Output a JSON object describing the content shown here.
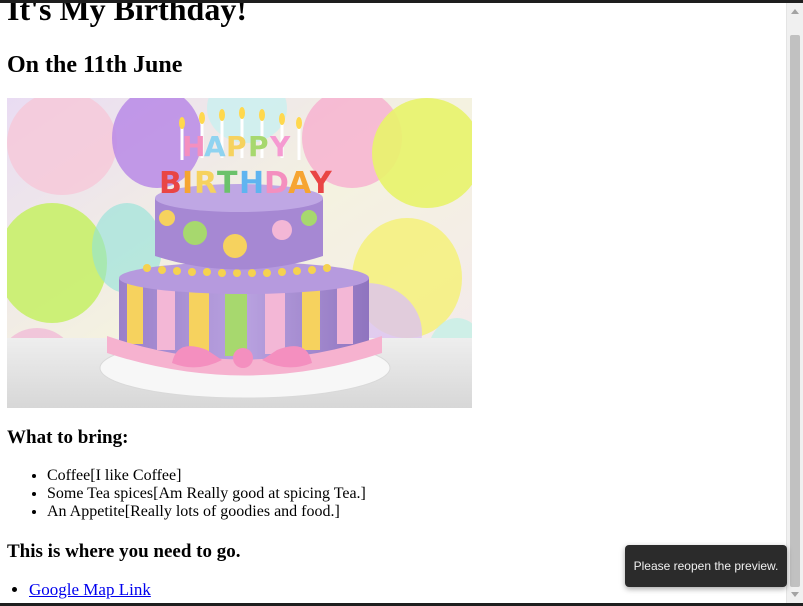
{
  "page": {
    "title": "It's My Birthday!",
    "subtitle": "On the 11th June"
  },
  "image": {
    "icon": "birthday-cake-image",
    "cake_text": "HAPPY BIRTHDAY"
  },
  "bring": {
    "heading": "What to bring:",
    "items": [
      "Coffee[I like Coffee]",
      "Some Tea spices[Am Really good at spicing Tea.]",
      "An Appetite[Really lots of goodies and food.]"
    ]
  },
  "location": {
    "heading": "This is where you need to go.",
    "link_label": "Google Map Link"
  },
  "toast": {
    "message": "Please reopen the preview."
  },
  "colors": {
    "link": "#0000ee",
    "toast_bg": "#2b2b2b"
  }
}
